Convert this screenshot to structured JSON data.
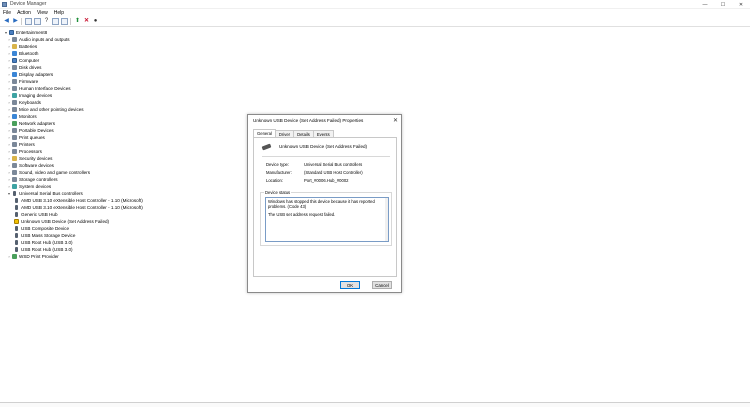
{
  "window": {
    "title": "Device Manager",
    "controls": [
      "—",
      "☐",
      "✕"
    ]
  },
  "menu": [
    "File",
    "Action",
    "View",
    "Help"
  ],
  "tree": {
    "root": "Entertainment8",
    "categories": [
      {
        "label": "Audio inputs and outputs",
        "icon": "speaker-icon"
      },
      {
        "label": "Batteries",
        "icon": "battery-icon"
      },
      {
        "label": "Bluetooth",
        "icon": "bluetooth-icon"
      },
      {
        "label": "Computer",
        "icon": "computer-icon"
      },
      {
        "label": "Disk drives",
        "icon": "disk-icon"
      },
      {
        "label": "Display adapters",
        "icon": "display-icon"
      },
      {
        "label": "Firmware",
        "icon": "firmware-icon"
      },
      {
        "label": "Human Interface Devices",
        "icon": "hid-icon"
      },
      {
        "label": "Imaging devices",
        "icon": "camera-icon"
      },
      {
        "label": "Keyboards",
        "icon": "keyboard-icon"
      },
      {
        "label": "Mice and other pointing devices",
        "icon": "mouse-icon"
      },
      {
        "label": "Monitors",
        "icon": "monitor-icon"
      },
      {
        "label": "Network adapters",
        "icon": "network-icon"
      },
      {
        "label": "Portable Devices",
        "icon": "portable-icon"
      },
      {
        "label": "Print queues",
        "icon": "printer-icon"
      },
      {
        "label": "Printers",
        "icon": "printer-icon"
      },
      {
        "label": "Processors",
        "icon": "processor-icon"
      },
      {
        "label": "Security devices",
        "icon": "security-icon"
      },
      {
        "label": "Software devices",
        "icon": "software-icon"
      },
      {
        "label": "Sound, video and game controllers",
        "icon": "sound-icon"
      },
      {
        "label": "Storage controllers",
        "icon": "storage-icon"
      },
      {
        "label": "System devices",
        "icon": "system-icon"
      }
    ],
    "usb_category": "Universal Serial Bus controllers",
    "usb_children": [
      "AMD USB 3.10 eXtensible Host Controller - 1.10 (Microsoft)",
      "AMD USB 3.10 eXtensible Host Controller - 1.10 (Microsoft)",
      "Generic USB Hub",
      "Unknown USB Device (Set Address Failed)",
      "USB Composite Device",
      "USB Mass Storage Device",
      "USB Root Hub (USB 3.0)",
      "USB Root Hub (USB 3.0)"
    ],
    "last_category": "WSD Print Provider"
  },
  "dialog": {
    "title": "Unknown USB Device (Set Address Failed) Properties",
    "tabs": [
      "General",
      "Driver",
      "Details",
      "Events"
    ],
    "device_name": "Unknown USB Device (Set Address Failed)",
    "props": {
      "type_label": "Device type:",
      "type_value": "Universal Serial Bus controllers",
      "mfr_label": "Manufacturer:",
      "mfr_value": "(Standard USB Host Controller)",
      "loc_label": "Location:",
      "loc_value": "Port_#0006.Hub_#0002"
    },
    "status_legend": "Device status",
    "status_line1": "Windows has stopped this device because it has reported problems. (Code 43)",
    "status_line2": "The USB set address request failed.",
    "ok": "OK",
    "cancel": "Cancel"
  }
}
